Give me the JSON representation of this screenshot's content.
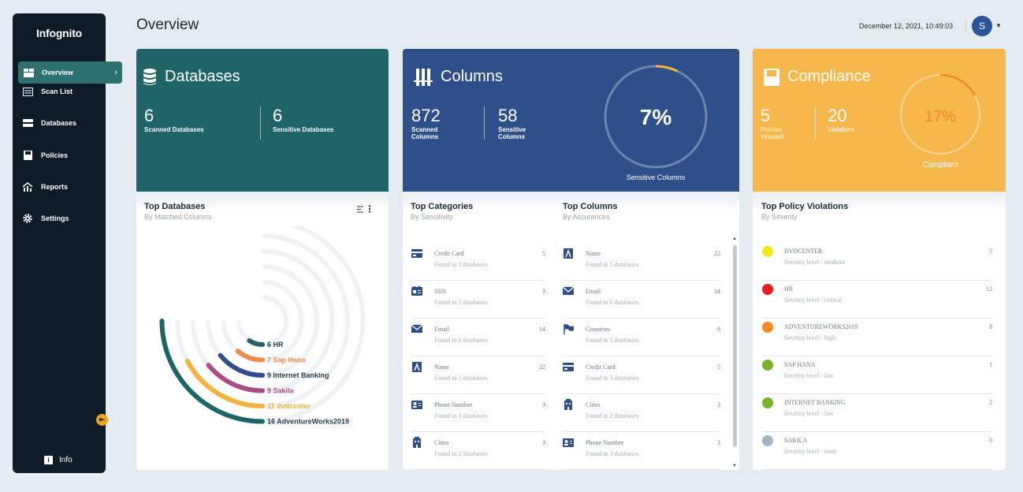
{
  "app": {
    "name": "Infognito"
  },
  "sidebar": {
    "items": [
      {
        "label": "Overview",
        "icon": "dashboard-icon"
      },
      {
        "label": "Scan List",
        "icon": "list-icon"
      },
      {
        "label": "Databases",
        "icon": "database-icon"
      },
      {
        "label": "Policies",
        "icon": "policy-icon"
      },
      {
        "label": "Reports",
        "icon": "reports-icon"
      },
      {
        "label": "Settings",
        "icon": "gear-icon"
      }
    ],
    "info_label": "Info"
  },
  "header": {
    "title": "Overview",
    "datetime": "December 12, 2021, 10:49:03",
    "avatar_initial": "S"
  },
  "databases_card": {
    "title": "Databases",
    "color": "#1f6466",
    "stats": [
      {
        "value": "6",
        "label": "Scanned Databases"
      },
      {
        "value": "6",
        "label": "Sensitive Databases"
      }
    ],
    "top_title": "Top Databases",
    "top_sub": "By Matched Columns"
  },
  "columns_card": {
    "title": "Columns",
    "color": "#2e4f8a",
    "stats": [
      {
        "value": "872",
        "label_line1": "Scanned",
        "label_line2": "Columns"
      },
      {
        "value": "58",
        "label_line1": "Sensitive",
        "label_line2": "Columns"
      }
    ],
    "gauge": {
      "percent_label": "7%",
      "value": 7,
      "caption": "Sensitive Columns",
      "accent": "#f4b33e"
    }
  },
  "compliance_card": {
    "title": "Compliance",
    "color": "#f7b84b",
    "stats": [
      {
        "value": "5",
        "label_line1": "Policies",
        "label_line2": "Violated"
      },
      {
        "value": "20",
        "label_line1": "Violations",
        "label_line2": ""
      }
    ],
    "gauge": {
      "percent_label": "17%",
      "value": 17,
      "caption": "Compliant",
      "accent": "#f28b1a"
    }
  },
  "top_categories": {
    "title": "Top Categories",
    "sub": "By Sensitivity",
    "items": [
      {
        "name": "Credit Card",
        "sub": "Found in 3 databases",
        "count": "5",
        "icon": "credit-card-icon"
      },
      {
        "name": "SSN",
        "sub": "Found in 2 databases",
        "count": "3",
        "icon": "id-card-icon"
      },
      {
        "name": "Email",
        "sub": "Found in 6 databases",
        "count": "14",
        "icon": "email-icon"
      },
      {
        "name": "Name",
        "sub": "Found in 5 databases",
        "count": "22",
        "icon": "name-icon"
      },
      {
        "name": "Phone Number",
        "sub": "Found in 3 databases",
        "count": "3",
        "icon": "contact-card-icon"
      },
      {
        "name": "Cities",
        "sub": "Found in 2 databases",
        "count": "3",
        "icon": "building-icon"
      }
    ]
  },
  "top_columns": {
    "title": "Top Columns",
    "sub": "By Accurences",
    "items": [
      {
        "name": "Name",
        "sub": "Found in 5 databases",
        "count": "22",
        "icon": "name-icon"
      },
      {
        "name": "Email",
        "sub": "Found in 6 databases",
        "count": "14",
        "icon": "email-icon"
      },
      {
        "name": "Countries",
        "sub": "Found in 5 databases",
        "count": "8",
        "icon": "flag-icon"
      },
      {
        "name": "Credit Card",
        "sub": "Found in 3 databases",
        "count": "5",
        "icon": "credit-card-icon"
      },
      {
        "name": "Cities",
        "sub": "Found in 2 databases",
        "count": "3",
        "icon": "building-icon"
      },
      {
        "name": "Phone Number",
        "sub": "Found in 3 databases",
        "count": "3",
        "icon": "contact-card-icon"
      }
    ]
  },
  "top_violations": {
    "title": "Top Policy Violations",
    "sub": "By Severity",
    "items": [
      {
        "name": "DVDCENTER",
        "sub": "Severity level - medium",
        "count": "5",
        "color": "#f5e81a"
      },
      {
        "name": "HR",
        "sub": "Severity level - critical",
        "count": "12",
        "color": "#ef1c1c"
      },
      {
        "name": "ADVENTUREWORKS2019",
        "sub": "Severity level - high",
        "count": "8",
        "color": "#f28b22"
      },
      {
        "name": "SAP HANA",
        "sub": "Severity level - low",
        "count": "1",
        "color": "#7bb32e"
      },
      {
        "name": "INTERNET BANKING",
        "sub": "Severity level - low",
        "count": "2",
        "color": "#7bb32e"
      },
      {
        "name": "SAKILA",
        "sub": "Severity level - none",
        "count": "0",
        "color": "#9fb6c4"
      }
    ]
  },
  "chart_data": {
    "type": "radial-bar",
    "title": "Top Databases",
    "subtitle": "By Matched Columns",
    "categories": [
      "HR",
      "Sap Hana",
      "Internet Banking",
      "Sakila",
      "dvdcenter",
      "AdventureWorks2019"
    ],
    "labels": [
      "6 HR",
      "7 Sap Hana",
      "9 Internet Banking",
      "9 Sakila",
      "11 dvdcenter",
      "16 AdventureWorks2019"
    ],
    "values": [
      6,
      7,
      9,
      9,
      11,
      16
    ],
    "colors": [
      "#1f6466",
      "#f08a4b",
      "#2e4f8a",
      "#a84e87",
      "#f4b33e",
      "#1f6466"
    ],
    "label_colors": [
      "#1f3b4d",
      "#f08a4b",
      "#1f3b4d",
      "#a84e87",
      "#f4b33e",
      "#1f3b4d"
    ]
  }
}
